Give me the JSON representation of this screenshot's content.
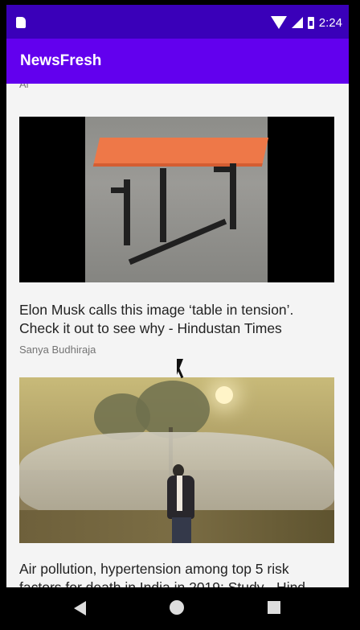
{
  "status_bar": {
    "time": "2:24",
    "icons": [
      "sim-card-icon",
      "wifi-icon",
      "signal-icon",
      "battery-icon"
    ]
  },
  "app": {
    "title": "NewsFresh",
    "colors": {
      "app_bar": "#6200ee",
      "status_bar": "#3a00b9"
    }
  },
  "feed": {
    "previous_author": "Ai",
    "articles": [
      {
        "headline": "Elon Musk calls this image ‘table in tension’. Check it out to see why - Hindustan Times",
        "author": "Sanya Budhiraja"
      },
      {
        "headline": "Air pollution, hypertension among top 5 risk factors for death in India in 2019: Study - Hind"
      }
    ]
  },
  "navigation": {
    "icons": [
      "back-icon",
      "home-icon",
      "recent-apps-icon"
    ]
  }
}
